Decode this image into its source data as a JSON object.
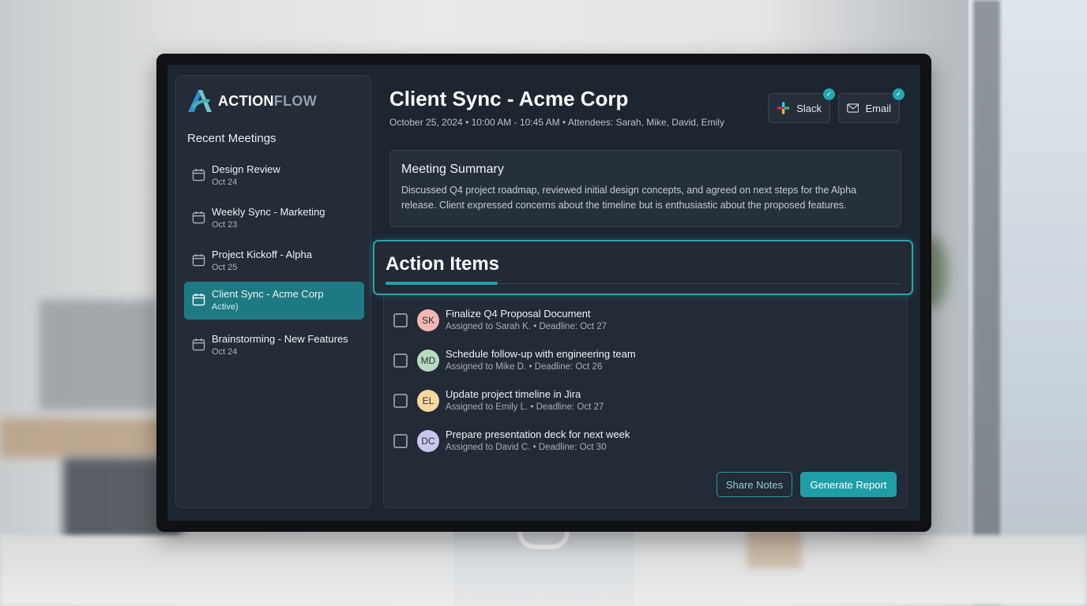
{
  "app": {
    "logo_part1": "ACTION",
    "logo_part2": "FLOW"
  },
  "sidebar": {
    "title": "Recent Meetings",
    "items": [
      {
        "name": "Design Review",
        "date": "Oct 24"
      },
      {
        "name": "Weekly Sync - Marketing",
        "date": "Oct 23"
      },
      {
        "name": "Project Kickoff - Alpha",
        "date": "Oct 25"
      },
      {
        "name": "Client Sync - Acme Corp",
        "date": "Active)"
      },
      {
        "name": "Brainstorming - New Features",
        "date": "Oct 24"
      }
    ]
  },
  "meeting": {
    "title": "Client Sync - Acme Corp",
    "subtitle": "October 25, 2024 • 10:00 AM - 10:45 AM • Attendees: Sarah, Mike, David, Emily"
  },
  "integrations": {
    "slack_label": "Slack",
    "email_label": "Email"
  },
  "summary": {
    "heading": "Meeting Summary",
    "text": "Discussed Q4 project roadmap, reviewed initial design concepts, and agreed on next steps for the Alpha release. Client expressed concerns about the timeline but is enthusiastic about the proposed features."
  },
  "actions": {
    "heading": "Action Items",
    "items": [
      {
        "initials": "SK",
        "title": "Finalize Q4 Proposal Document",
        "meta": "Assigned to Sarah K. • Deadline: Oct 27",
        "color": "#f2b8b0"
      },
      {
        "initials": "MD",
        "title": "Schedule follow-up with engineering team",
        "meta": "Assigned to Mike D. • Deadline: Oct 26",
        "color": "#b6dcc0"
      },
      {
        "initials": "EL",
        "title": "Update project timeline in Jira",
        "meta": "Assigned to Emily L. • Deadline: Oct 27",
        "color": "#f6d79e"
      },
      {
        "initials": "DC",
        "title": "Prepare presentation deck for next week",
        "meta": "Assigned to David C. • Deadline: Oct 30",
        "color": "#c9c6ef"
      }
    ],
    "share_label": "Share Notes",
    "generate_label": "Generate Report"
  },
  "colors": {
    "accent": "#1f9ea7",
    "background": "#1d2530"
  }
}
